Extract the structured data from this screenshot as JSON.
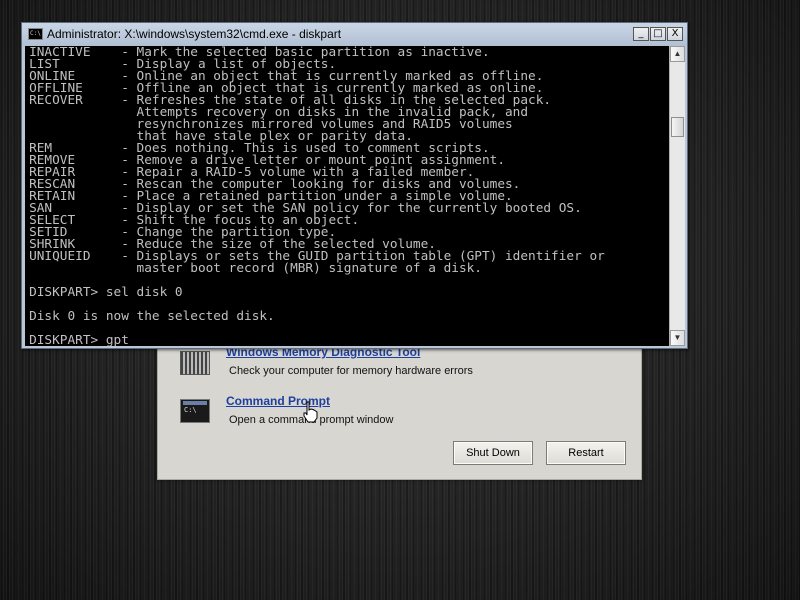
{
  "recovery_panel": {
    "memory_tool": {
      "title": "Windows Memory Diagnostic Tool",
      "description": "Check your computer for memory hardware errors",
      "icon": "memory-chip-icon"
    },
    "command_prompt": {
      "title": "Command Prompt",
      "description": "Open a command prompt window",
      "icon": "command-prompt-icon"
    },
    "shutdown_label": "Shut Down",
    "restart_label": "Restart"
  },
  "cmd_window": {
    "title": "Administrator: X:\\windows\\system32\\cmd.exe - diskpart",
    "icon_text": "C:\\",
    "minimize": "_",
    "maximize": "□",
    "close": "X",
    "lines": [
      "INACTIVE    - Mark the selected basic partition as inactive.",
      "LIST        - Display a list of objects.",
      "ONLINE      - Online an object that is currently marked as offline.",
      "OFFLINE     - Offline an object that is currently marked as online.",
      "RECOVER     - Refreshes the state of all disks in the selected pack.",
      "              Attempts recovery on disks in the invalid pack, and",
      "              resynchronizes mirrored volumes and RAID5 volumes",
      "              that have stale plex or parity data.",
      "REM         - Does nothing. This is used to comment scripts.",
      "REMOVE      - Remove a drive letter or mount point assignment.",
      "REPAIR      - Repair a RAID-5 volume with a failed member.",
      "RESCAN      - Rescan the computer looking for disks and volumes.",
      "RETAIN      - Place a retained partition under a simple volume.",
      "SAN         - Display or set the SAN policy for the currently booted OS.",
      "SELECT      - Shift the focus to an object.",
      "SETID       - Change the partition type.",
      "SHRINK      - Reduce the size of the selected volume.",
      "UNIQUEID    - Displays or sets the GUID partition table (GPT) identifier or",
      "              master boot record (MBR) signature of a disk.",
      "",
      "DISKPART> sel disk 0",
      "",
      "Disk 0 is now the selected disk.",
      "",
      "DISKPART> gpt"
    ]
  }
}
